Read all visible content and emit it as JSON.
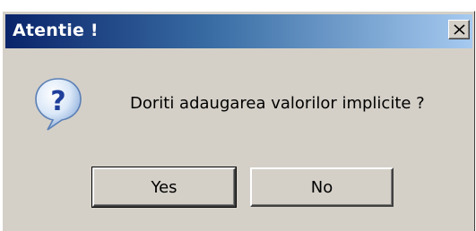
{
  "dialog": {
    "title": "Atentie !",
    "message": "Doriti adaugarea valorilor implicite ?",
    "icon": "question-icon",
    "close_icon": "close-icon",
    "buttons": {
      "yes_label": "Yes",
      "no_label": "No"
    },
    "colors": {
      "titlebar_start": "#0a246a",
      "titlebar_end": "#a6caf0",
      "face": "#d4d0c8"
    }
  }
}
